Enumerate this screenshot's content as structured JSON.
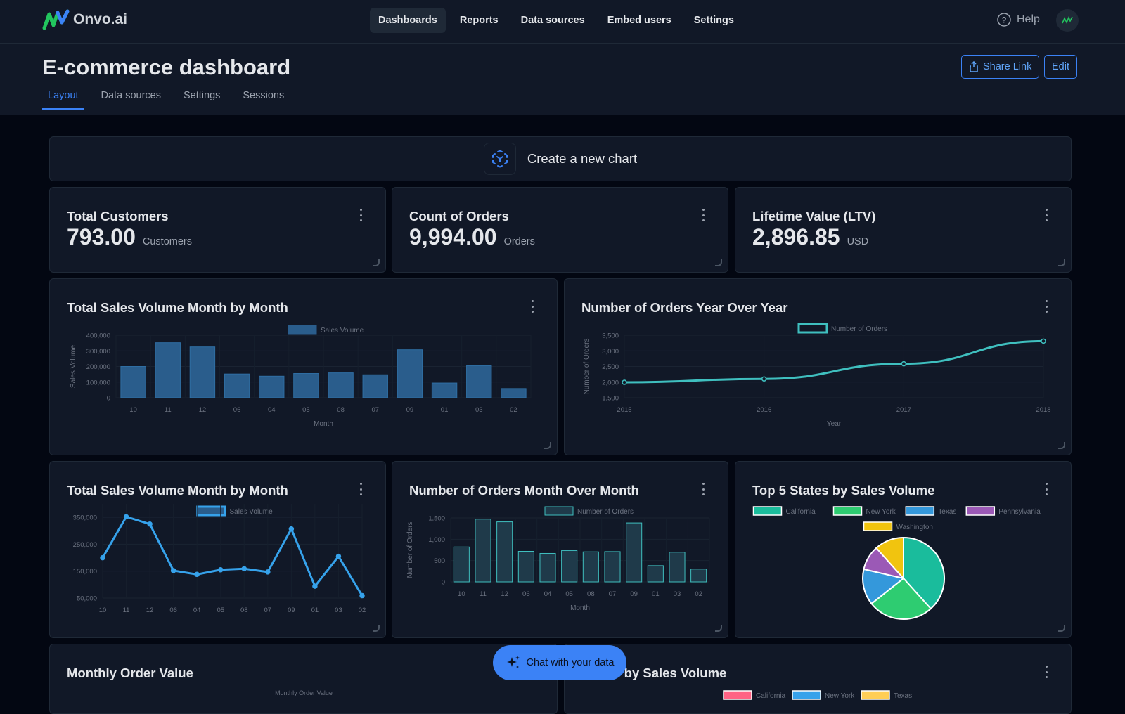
{
  "app": {
    "name": "Onvo.ai"
  },
  "nav": {
    "items": [
      {
        "label": "Dashboards",
        "active": true
      },
      {
        "label": "Reports"
      },
      {
        "label": "Data sources"
      },
      {
        "label": "Embed users"
      },
      {
        "label": "Settings"
      }
    ],
    "help": "Help"
  },
  "header": {
    "title": "E-commerce dashboard",
    "share_label": "Share Link",
    "edit_label": "Edit",
    "tabs": [
      {
        "label": "Layout",
        "active": true
      },
      {
        "label": "Data sources"
      },
      {
        "label": "Settings"
      },
      {
        "label": "Sessions"
      }
    ]
  },
  "create_chart": {
    "label": "Create a new chart"
  },
  "kpis": [
    {
      "title": "Total Customers",
      "value": "793.00",
      "unit": "Customers"
    },
    {
      "title": "Count of Orders",
      "value": "9,994.00",
      "unit": "Orders"
    },
    {
      "title": "Lifetime Value (LTV)",
      "value": "2,896.85",
      "unit": "USD"
    }
  ],
  "chat": {
    "label": "Chat with your data"
  },
  "colors": {
    "accent": "#3b82f6",
    "bar": "#2a5d8c",
    "teal": "#3fbfbf",
    "line_blue": "#36a2eb"
  },
  "chart_data": [
    {
      "id": "sales_bar",
      "type": "bar",
      "title": "Total Sales Volume Month by Month",
      "legend": "Sales Volume",
      "xlabel": "Month",
      "ylabel": "Sales Volume",
      "categories": [
        "10",
        "11",
        "12",
        "06",
        "04",
        "05",
        "08",
        "07",
        "09",
        "01",
        "03",
        "02"
      ],
      "values": [
        200000,
        352000,
        325000,
        152000,
        138000,
        155000,
        159000,
        147000,
        307000,
        94000,
        205000,
        59000
      ],
      "ylim": [
        0,
        400000
      ],
      "yticks": [
        "0",
        "100,000",
        "200,000",
        "300,000",
        "400,000"
      ],
      "grid": true,
      "legend_position": "top"
    },
    {
      "id": "orders_yoy",
      "type": "line",
      "title": "Number of Orders Year Over Year",
      "legend": "Number of Orders",
      "xlabel": "Year",
      "ylabel": "Number of Orders",
      "categories": [
        "2015",
        "2016",
        "2017",
        "2018"
      ],
      "values": [
        1993,
        2102,
        2587,
        3312
      ],
      "ylim": [
        1500,
        3500
      ],
      "yticks": [
        "1,500",
        "2,000",
        "2,500",
        "3,000",
        "3,500"
      ],
      "grid": true,
      "legend_position": "top"
    },
    {
      "id": "sales_line",
      "type": "line",
      "title": "Total Sales Volume Month by Month",
      "legend": "Sales Volume",
      "xlabel": "",
      "ylabel": "",
      "categories": [
        "10",
        "11",
        "12",
        "06",
        "04",
        "05",
        "08",
        "07",
        "09",
        "01",
        "03",
        "02"
      ],
      "values": [
        200000,
        352000,
        325000,
        152000,
        138000,
        155000,
        159000,
        147000,
        307000,
        94000,
        205000,
        59000
      ],
      "ylim": [
        50000,
        400000
      ],
      "yticks": [
        "50,000",
        "150,000",
        "250,000",
        "350,000"
      ],
      "grid": true,
      "legend_position": "top"
    },
    {
      "id": "orders_mom",
      "type": "bar",
      "title": "Number of Orders Month Over Month",
      "legend": "Number of Orders",
      "xlabel": "Month",
      "ylabel": "Number of Orders",
      "categories": [
        "10",
        "11",
        "12",
        "06",
        "04",
        "05",
        "08",
        "07",
        "09",
        "01",
        "03",
        "02"
      ],
      "values": [
        819,
        1471,
        1408,
        717,
        668,
        735,
        705,
        710,
        1383,
        381,
        696,
        300
      ],
      "ylim": [
        0,
        1500
      ],
      "yticks": [
        "0",
        "500",
        "1,000",
        "1,500"
      ],
      "grid": true,
      "legend_position": "top"
    },
    {
      "id": "top_states",
      "type": "pie",
      "title": "Top 5 States by Sales Volume",
      "labels": [
        "California",
        "New York",
        "Texas",
        "Pennsylvania",
        "Washington"
      ],
      "values": [
        457688,
        310876,
        170188,
        116512,
        138641
      ],
      "colors": [
        "#1abc9c",
        "#2ecc71",
        "#3498db",
        "#9b59b6",
        "#f1c40f"
      ],
      "legend_position": "top"
    },
    {
      "id": "monthly_order_value",
      "type": "line",
      "title": "Monthly Order Value",
      "legend": "Monthly Order Value"
    },
    {
      "id": "states_bottom",
      "type": "pie",
      "title": "States by Sales Volume",
      "labels": [
        "California",
        "New York",
        "Texas"
      ],
      "colors": [
        "#ff6384",
        "#36a2eb",
        "#ffce56"
      ]
    }
  ]
}
